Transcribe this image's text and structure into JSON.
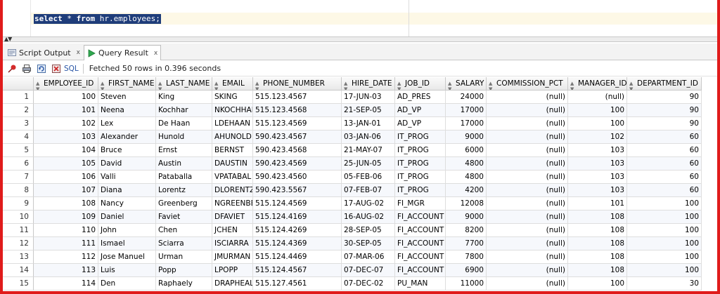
{
  "editor": {
    "sql_keyword_select": "select",
    "sql_star": "*",
    "sql_keyword_from": "from",
    "sql_table": "hr.employees;"
  },
  "tabs": [
    {
      "label": "Script Output",
      "close": "x"
    },
    {
      "label": "Query Result",
      "close": "x"
    }
  ],
  "toolbar": {
    "sql_label": "SQL",
    "status": "Fetched 50 rows in 0.396 seconds"
  },
  "columns": [
    "EMPLOYEE_ID",
    "FIRST_NAME",
    "LAST_NAME",
    "EMAIL",
    "PHONE_NUMBER",
    "HIRE_DATE",
    "JOB_ID",
    "SALARY",
    "COMMISSION_PCT",
    "MANAGER_ID",
    "DEPARTMENT_ID"
  ],
  "rows": [
    {
      "n": "1",
      "c": [
        "100",
        "Steven",
        "King",
        "SKING",
        "515.123.4567",
        "17-JUN-03",
        "AD_PRES",
        "24000",
        "(null)",
        "(null)",
        "90"
      ]
    },
    {
      "n": "2",
      "c": [
        "101",
        "Neena",
        "Kochhar",
        "NKOCHHAR",
        "515.123.4568",
        "21-SEP-05",
        "AD_VP",
        "17000",
        "(null)",
        "100",
        "90"
      ]
    },
    {
      "n": "3",
      "c": [
        "102",
        "Lex",
        "De Haan",
        "LDEHAAN",
        "515.123.4569",
        "13-JAN-01",
        "AD_VP",
        "17000",
        "(null)",
        "100",
        "90"
      ]
    },
    {
      "n": "4",
      "c": [
        "103",
        "Alexander",
        "Hunold",
        "AHUNOLD",
        "590.423.4567",
        "03-JAN-06",
        "IT_PROG",
        "9000",
        "(null)",
        "102",
        "60"
      ]
    },
    {
      "n": "5",
      "c": [
        "104",
        "Bruce",
        "Ernst",
        "BERNST",
        "590.423.4568",
        "21-MAY-07",
        "IT_PROG",
        "6000",
        "(null)",
        "103",
        "60"
      ]
    },
    {
      "n": "6",
      "c": [
        "105",
        "David",
        "Austin",
        "DAUSTIN",
        "590.423.4569",
        "25-JUN-05",
        "IT_PROG",
        "4800",
        "(null)",
        "103",
        "60"
      ]
    },
    {
      "n": "7",
      "c": [
        "106",
        "Valli",
        "Pataballa",
        "VPATABAL",
        "590.423.4560",
        "05-FEB-06",
        "IT_PROG",
        "4800",
        "(null)",
        "103",
        "60"
      ]
    },
    {
      "n": "8",
      "c": [
        "107",
        "Diana",
        "Lorentz",
        "DLORENTZ",
        "590.423.5567",
        "07-FEB-07",
        "IT_PROG",
        "4200",
        "(null)",
        "103",
        "60"
      ]
    },
    {
      "n": "9",
      "c": [
        "108",
        "Nancy",
        "Greenberg",
        "NGREENBE",
        "515.124.4569",
        "17-AUG-02",
        "FI_MGR",
        "12008",
        "(null)",
        "101",
        "100"
      ]
    },
    {
      "n": "10",
      "c": [
        "109",
        "Daniel",
        "Faviet",
        "DFAVIET",
        "515.124.4169",
        "16-AUG-02",
        "FI_ACCOUNT",
        "9000",
        "(null)",
        "108",
        "100"
      ]
    },
    {
      "n": "11",
      "c": [
        "110",
        "John",
        "Chen",
        "JCHEN",
        "515.124.4269",
        "28-SEP-05",
        "FI_ACCOUNT",
        "8200",
        "(null)",
        "108",
        "100"
      ]
    },
    {
      "n": "12",
      "c": [
        "111",
        "Ismael",
        "Sciarra",
        "ISCIARRA",
        "515.124.4369",
        "30-SEP-05",
        "FI_ACCOUNT",
        "7700",
        "(null)",
        "108",
        "100"
      ]
    },
    {
      "n": "13",
      "c": [
        "112",
        "Jose Manuel",
        "Urman",
        "JMURMAN",
        "515.124.4469",
        "07-MAR-06",
        "FI_ACCOUNT",
        "7800",
        "(null)",
        "108",
        "100"
      ]
    },
    {
      "n": "14",
      "c": [
        "113",
        "Luis",
        "Popp",
        "LPOPP",
        "515.124.4567",
        "07-DEC-07",
        "FI_ACCOUNT",
        "6900",
        "(null)",
        "108",
        "100"
      ]
    },
    {
      "n": "15",
      "c": [
        "114",
        "Den",
        "Raphaely",
        "DRAPHEAL",
        "515.127.4561",
        "07-DEC-02",
        "PU_MAN",
        "11000",
        "(null)",
        "100",
        "30"
      ]
    }
  ]
}
